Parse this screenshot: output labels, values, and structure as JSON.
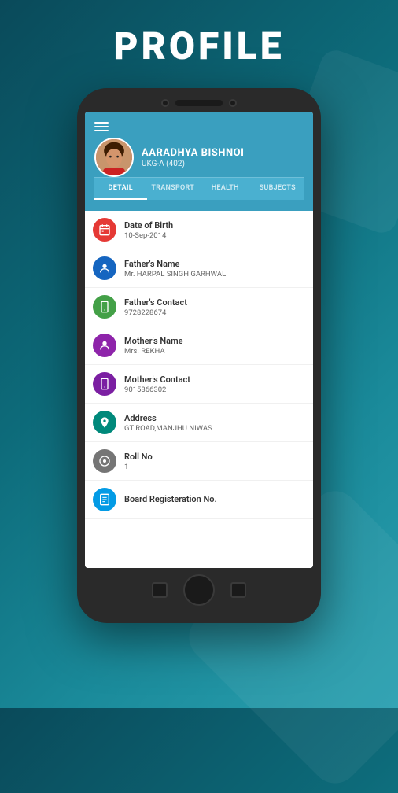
{
  "page": {
    "title": "PROFILE",
    "background_top_color": "#0a4a5a",
    "background_bottom_color": "#1a8a9a"
  },
  "phone": {
    "status_bar": ""
  },
  "app": {
    "header_color": "#3a9fbf",
    "student_name": "AARADHYA BISHNOI",
    "student_class": "UKG-A (402)",
    "tabs": [
      {
        "label": "DETAIL",
        "active": true
      },
      {
        "label": "TRANSPORT",
        "active": false
      },
      {
        "label": "HEALTH",
        "active": false
      },
      {
        "label": "SUBJECTS",
        "active": false
      }
    ],
    "info_rows": [
      {
        "icon_color": "ic-red",
        "icon_symbol": "📅",
        "label": "Date of Birth",
        "value": "10-Sep-2014"
      },
      {
        "icon_color": "ic-blue-dark",
        "icon_symbol": "👤",
        "label": "Father's Name",
        "value": "Mr. HARPAL SINGH GARHWAL"
      },
      {
        "icon_color": "ic-green",
        "icon_symbol": "📱",
        "label": "Father's Contact",
        "value": "9728228674"
      },
      {
        "icon_color": "ic-purple",
        "icon_symbol": "👤",
        "label": "Mother's Name",
        "value": "Mrs. REKHA"
      },
      {
        "icon_color": "ic-purple2",
        "icon_symbol": "📱",
        "label": "Mother's Contact",
        "value": "9015866302"
      },
      {
        "icon_color": "ic-teal",
        "icon_symbol": "🏠",
        "label": "Address",
        "value": "GT ROAD,MANJHU NIWAS"
      },
      {
        "icon_color": "ic-gray",
        "icon_symbol": "⊙",
        "label": "Roll No",
        "value": "1"
      },
      {
        "icon_color": "ic-light-blue",
        "icon_symbol": "📋",
        "label": "Board Registeration No.",
        "value": ""
      }
    ]
  }
}
